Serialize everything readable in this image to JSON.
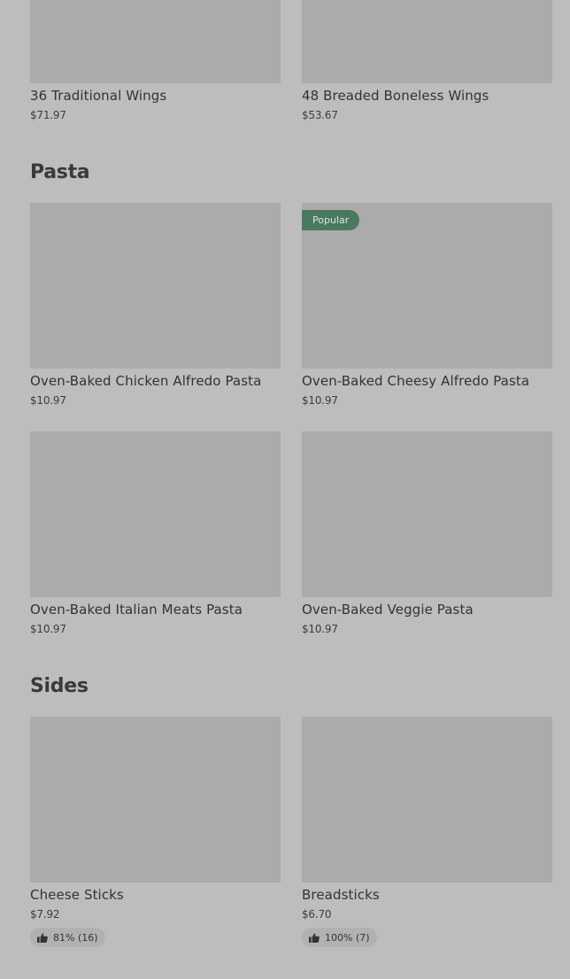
{
  "wings": {
    "items": [
      {
        "name": "36 Traditional Wings",
        "price": "$71.97"
      },
      {
        "name": "48 Breaded Boneless Wings",
        "price": "$53.67"
      }
    ]
  },
  "pasta": {
    "heading": "Pasta",
    "items": [
      {
        "name": "Oven-Baked Chicken Alfredo Pasta",
        "price": "$10.97"
      },
      {
        "name": "Oven-Baked Cheesy Alfredo Pasta",
        "price": "$10.97",
        "badge": "Popular"
      },
      {
        "name": "Oven-Baked Italian Meats Pasta",
        "price": "$10.97"
      },
      {
        "name": "Oven-Baked Veggie Pasta",
        "price": "$10.97"
      }
    ]
  },
  "sides": {
    "heading": "Sides",
    "items": [
      {
        "name": "Cheese Sticks",
        "price": "$7.92",
        "rating": "81% (16)"
      },
      {
        "name": "Breadsticks",
        "price": "$6.70",
        "rating": "100% (7)"
      }
    ]
  },
  "colors": {
    "background": "#bdbdbd",
    "image_placeholder": "#ababab",
    "popular_badge": "#4a7a5d"
  },
  "icons": {
    "rating": "thumbs-up-icon"
  }
}
